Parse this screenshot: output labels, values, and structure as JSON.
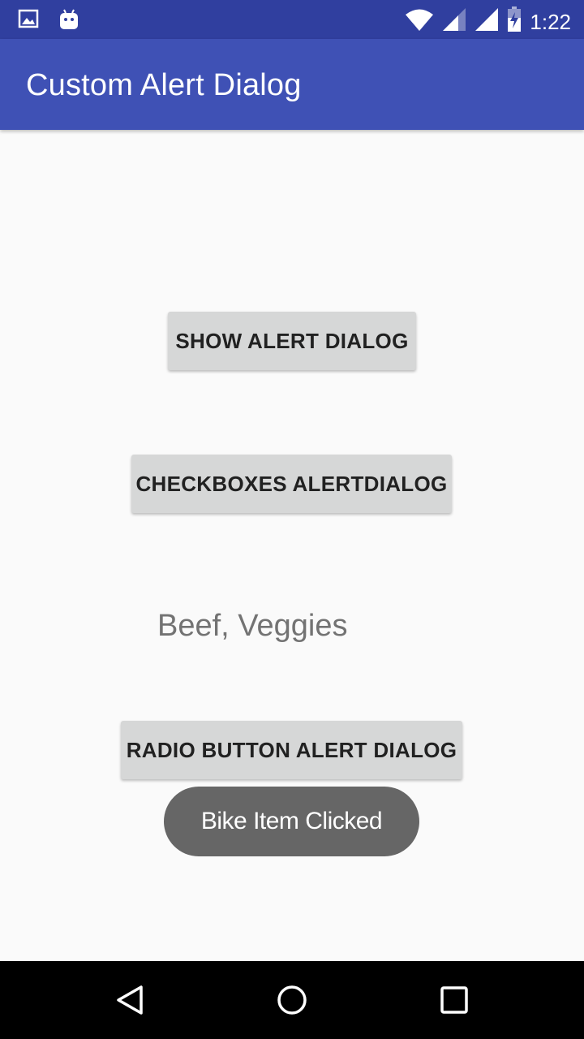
{
  "status_bar": {
    "time": "1:22",
    "icons": [
      "image-icon",
      "android-icon",
      "wifi-icon",
      "signal-icon",
      "signal-icon",
      "battery-charging-icon"
    ]
  },
  "app_bar": {
    "title": "Custom Alert Dialog"
  },
  "main": {
    "show_alert_label": "SHOW ALERT DIALOG",
    "checkboxes_label": "CHECKBOXES ALERTDIALOG",
    "selected_items": "Beef, Veggies",
    "radio_label": "RADIO BUTTON ALERT DIALOG"
  },
  "toast": {
    "message": "Bike Item Clicked"
  },
  "nav_bar": {
    "icons": [
      "back-icon",
      "home-icon",
      "recents-icon"
    ]
  },
  "colors": {
    "primary": "#3f51b5",
    "primary_dark": "#303f9f",
    "button_bg": "#d6d7d7",
    "toast_bg": "#666666"
  }
}
